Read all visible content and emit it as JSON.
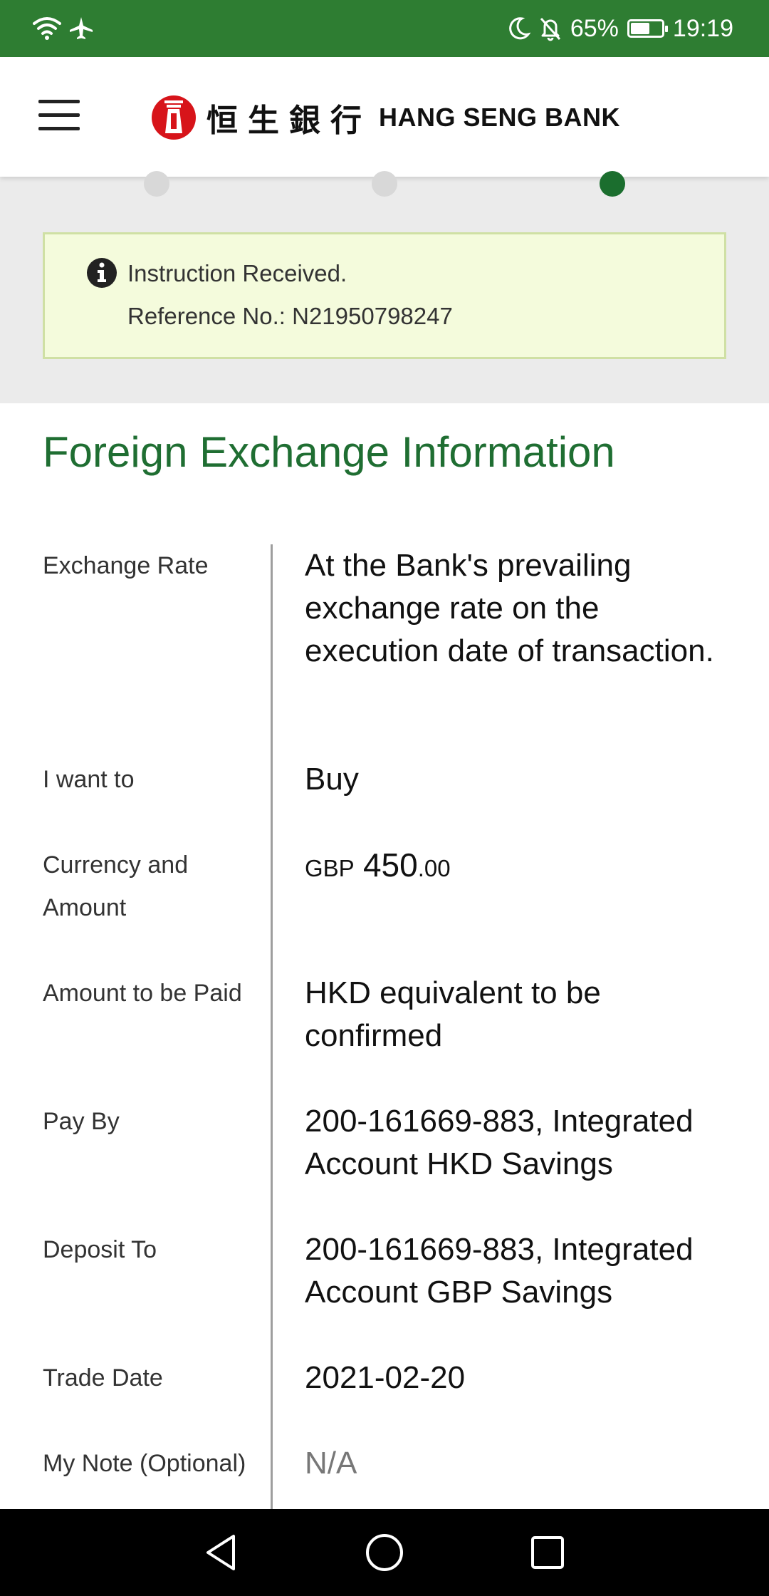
{
  "status_bar": {
    "left_icons": [
      "wifi-icon",
      "airplane-icon"
    ],
    "right_icons": [
      "moon-icon",
      "bell-off-icon",
      "battery-icon"
    ],
    "battery": "65%",
    "battery_level": 0.65,
    "time": "19:19"
  },
  "header": {
    "menu_icon": "hamburger-menu-icon",
    "logo_icon": "hang-seng-logo-icon",
    "logo_cn": "恒生銀行",
    "logo_en": "HANG SENG BANK"
  },
  "progress": {
    "total_steps": 3,
    "current_step": 3
  },
  "notice": {
    "icon": "info-icon",
    "line1": "Instruction Received.",
    "line2": "Reference No.: N21950798247"
  },
  "section_title": "Foreign Exchange Information",
  "rows": {
    "exchange_rate": {
      "label": "Exchange Rate",
      "value": "At the Bank's prevailing exchange rate on the execution date of transaction."
    },
    "i_want_to": {
      "label": "I want to",
      "value": "Buy"
    },
    "currency_amount": {
      "label": "Currency and Amount",
      "currency": "GBP",
      "amount_int": "450",
      "amount_dec": ".00"
    },
    "amount_paid": {
      "label": "Amount to be Paid",
      "value": "HKD equivalent to be confirmed"
    },
    "pay_by": {
      "label": "Pay By",
      "value": "200-161669-883, Integrated Account HKD Savings"
    },
    "deposit_to": {
      "label": "Deposit To",
      "value": "200-161669-883, Integrated Account GBP Savings"
    },
    "trade_date": {
      "label": "Trade Date",
      "value": "2021-02-20"
    },
    "my_note": {
      "label": "My Note (Optional)",
      "value": "N/A"
    }
  },
  "nav_bar": {
    "back_icon": "back-triangle-icon",
    "home_icon": "home-circle-icon",
    "recents_icon": "recents-square-icon"
  }
}
